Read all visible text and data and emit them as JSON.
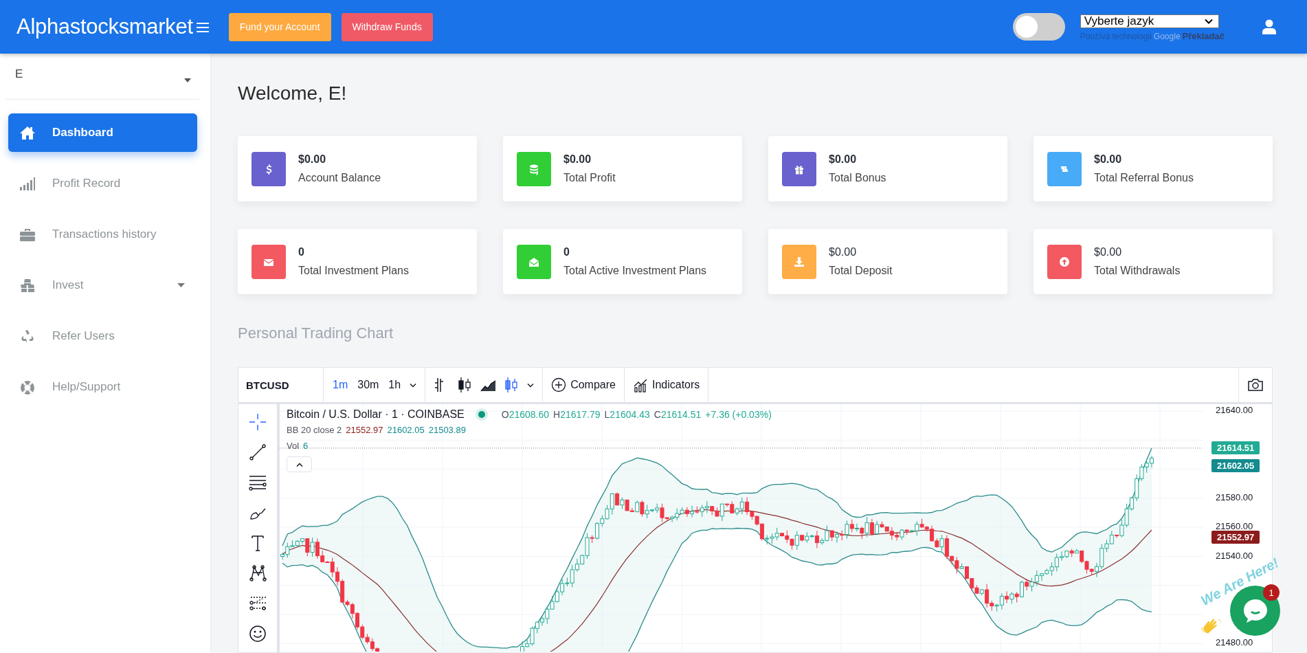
{
  "header": {
    "logo": "Alphastocksmarket",
    "buttons": [
      {
        "label": "Fund your Account",
        "kind": "warning"
      },
      {
        "label": "Withdraw Funds",
        "kind": "danger"
      }
    ],
    "theme_toggle": {
      "on": false
    },
    "language_select": {
      "value": "Vyberte jazyk"
    },
    "translate_credit": {
      "prefix": "Používá technologii",
      "brand": "Google",
      "product": "Překladač"
    }
  },
  "sidebar": {
    "user": "E",
    "items": [
      {
        "label": "Dashboard",
        "kind": "home",
        "selected": true,
        "has_submenu": false
      },
      {
        "label": "Profit Record",
        "kind": "signal",
        "selected": false,
        "has_submenu": false
      },
      {
        "label": "Transactions history",
        "kind": "briefcase",
        "selected": false,
        "has_submenu": false
      },
      {
        "label": "Invest",
        "kind": "cubes",
        "selected": false,
        "has_submenu": true
      },
      {
        "label": "Refer Users",
        "kind": "recycle",
        "selected": false,
        "has_submenu": false
      },
      {
        "label": "Help/Support",
        "kind": "lifering",
        "selected": false,
        "has_submenu": false
      }
    ]
  },
  "welcome": "Welcome, E!",
  "cards": [
    {
      "value": "$0.00",
      "label": "Account Balance",
      "kind": "dollar",
      "color": "#6861ce",
      "value_bold": true
    },
    {
      "value": "$0.00",
      "label": "Total Profit",
      "kind": "coins",
      "color": "#31ce36",
      "value_bold": true
    },
    {
      "value": "$0.00",
      "label": "Total Bonus",
      "kind": "gift",
      "color": "#6861ce",
      "value_bold": true
    },
    {
      "value": "$0.00",
      "label": "Total Referral Bonus",
      "kind": "retweet",
      "color": "#48abf7",
      "value_bold": true
    },
    {
      "value": "0",
      "label": "Total Investment Plans",
      "kind": "envelope",
      "color": "#f25961",
      "value_bold": true
    },
    {
      "value": "0",
      "label": "Total Active Investment Plans",
      "kind": "envelope-open",
      "color": "#31ce36",
      "value_bold": true
    },
    {
      "value": "$0.00",
      "label": "Total Deposit",
      "kind": "download",
      "color": "#ffad46",
      "value_bold": false
    },
    {
      "value": "$0.00",
      "label": "Total Withdrawals",
      "kind": "arrow-up",
      "color": "#f25961",
      "value_bold": false
    }
  ],
  "chart_section": {
    "title": "Personal Trading Chart",
    "toolbar": {
      "symbol": "BTCUSD",
      "intervals": [
        {
          "label": "1m",
          "selected": true
        },
        {
          "label": "30m",
          "selected": false
        },
        {
          "label": "1h",
          "selected": false
        }
      ],
      "chart_types": [
        {
          "kind": "bars",
          "selected": false
        },
        {
          "kind": "candles",
          "selected": false
        },
        {
          "kind": "area",
          "selected": false
        },
        {
          "kind": "hollow-candles",
          "selected": true
        }
      ],
      "buttons": [
        {
          "label": "Compare",
          "kind": "plus"
        },
        {
          "label": "Indicators",
          "kind": "indicators"
        }
      ]
    },
    "tools": [
      {
        "kind": "crosshair",
        "selected": true
      },
      {
        "kind": "trend-line",
        "selected": false
      },
      {
        "kind": "fib",
        "selected": false
      },
      {
        "kind": "brush",
        "selected": false
      },
      {
        "kind": "text",
        "selected": false
      },
      {
        "kind": "pattern",
        "selected": false
      },
      {
        "kind": "prediction",
        "selected": false
      },
      {
        "kind": "emoji",
        "selected": false
      }
    ],
    "legend": {
      "title": "Bitcoin / U.S. Dollar · 1 · COINBASE",
      "market_open": true,
      "ohlc": [
        {
          "label": "O",
          "value": "21608.60"
        },
        {
          "label": "H",
          "value": "21617.79"
        },
        {
          "label": "L",
          "value": "21604.43"
        },
        {
          "label": "C",
          "value": "21614.51"
        }
      ],
      "change": "+7.36 (+0.03%)",
      "indicator": {
        "label": "BB 20 close 2",
        "values": [
          {
            "value": "21552.97",
            "color": "#8c1c1c"
          },
          {
            "value": "21602.05",
            "color": "#138b8f"
          },
          {
            "value": "21503.89",
            "color": "#138b8f"
          }
        ]
      },
      "volume": {
        "label": "Vol",
        "value": "6"
      }
    },
    "price_axis": [
      "21640.00",
      "21580.00",
      "21560.00",
      "21540.00",
      "21480.00"
    ],
    "price_tags": [
      {
        "value": "21614.51",
        "color": "#22ab94"
      },
      {
        "value": "21602.05",
        "color": "#138b8f"
      },
      {
        "value": "21552.97",
        "color": "#8c1c1c"
      }
    ]
  },
  "chat_widget": {
    "tagline": "We Are Here!",
    "badge": "1"
  }
}
